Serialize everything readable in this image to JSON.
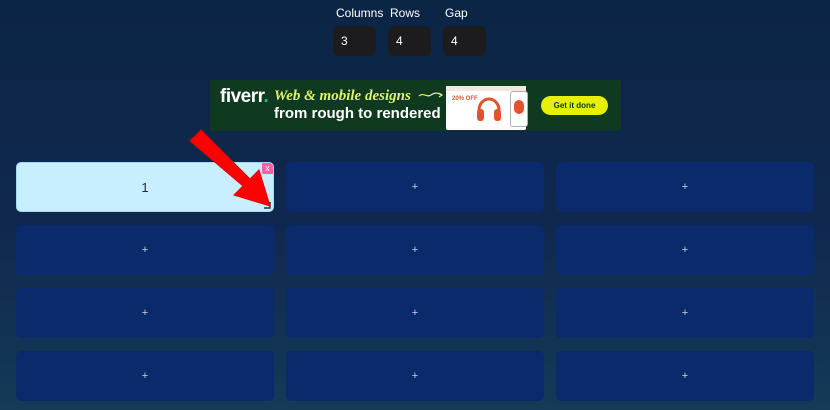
{
  "controls": {
    "columns": {
      "label": "Columns",
      "value": "3"
    },
    "rows": {
      "label": "Rows",
      "value": "4"
    },
    "gap": {
      "label": "Gap",
      "value": "4"
    }
  },
  "ad": {
    "logo": "fiverr",
    "logo_dot": ".",
    "line1": "Web & mobile designs",
    "line2": "from rough to rendered",
    "mock_text": "20% OFF",
    "cta": "Get it done",
    "colors": {
      "background": "#0f3a1f",
      "cta": "#e6f000",
      "accent": "#dff36a"
    }
  },
  "grid": {
    "cells": [
      {
        "label": "1",
        "filled": true,
        "remove": "x"
      },
      {
        "label": "+"
      },
      {
        "label": "+"
      },
      {
        "label": "+"
      },
      {
        "label": "+"
      },
      {
        "label": "+"
      },
      {
        "label": "+"
      },
      {
        "label": "+"
      },
      {
        "label": "+"
      },
      {
        "label": "+"
      },
      {
        "label": "+"
      },
      {
        "label": "+"
      }
    ]
  },
  "colors": {
    "cell_empty": "#0b2a6b",
    "cell_filled": "#c8eeff",
    "remove_badge": "#ff5fa2",
    "arrow": "#ff0000"
  },
  "icons": {
    "remove": "close-icon",
    "resize": "resize-handle-icon",
    "annotation": "arrow-icon"
  }
}
